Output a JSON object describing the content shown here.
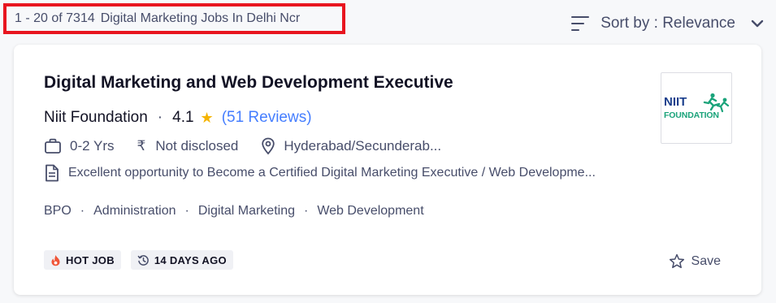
{
  "results": {
    "range": "1 - 20 of 7314",
    "heading": "Digital Marketing Jobs In Delhi Ncr"
  },
  "sort": {
    "label": "Sort by : Relevance"
  },
  "job": {
    "title": "Digital Marketing and Web Development Executive",
    "company": "Niit Foundation",
    "rating": "4.1",
    "reviews": "(51 Reviews)",
    "experience": "0-2 Yrs",
    "salary": "Not disclosed",
    "location": "Hyderabad/Secunderab...",
    "description": "Excellent opportunity to Become a Certified Digital Marketing Executive / Web Developme...",
    "tags": [
      "BPO",
      "Administration",
      "Digital Marketing",
      "Web Development"
    ],
    "logo_text": [
      "NIIT",
      "FOUNDATION"
    ],
    "badges": {
      "hot": "HOT JOB",
      "age": "14 DAYS AGO"
    },
    "save_label": "Save"
  },
  "icons": {
    "sort": "sort-lines-icon",
    "chevron": "chevron-down-icon",
    "briefcase": "briefcase-icon",
    "rupee": "rupee-icon",
    "location": "location-pin-icon",
    "document": "document-icon",
    "star": "star-icon",
    "fire": "fire-icon",
    "history": "history-clock-icon",
    "save": "star-outline-icon"
  },
  "colors": {
    "highlight_border": "#e8151f",
    "rating_star": "#f5b400",
    "reviews_link": "#457eff",
    "logo_text": "#1a3e8c",
    "logo_figure": "#1aa37a",
    "hot_icon": "#f05537"
  }
}
